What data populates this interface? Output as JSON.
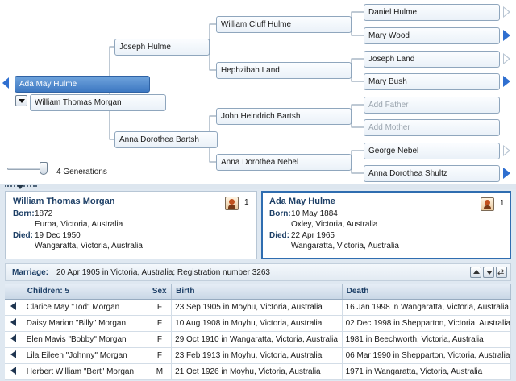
{
  "pedigree": {
    "root": "Ada May Hulme",
    "spouse": "William Thomas Morgan",
    "father": "Joseph Hulme",
    "mother": "Anna Dorothea Bartsh",
    "pat_grandfather": "William Cluff Hulme",
    "pat_grandmother": "Hephzibah Land",
    "mat_grandfather": "John Heindrich Bartsh",
    "mat_grandmother": "Anna Dorothea Nebel",
    "g1": "Daniel Hulme",
    "g2": "Mary Wood",
    "g3": "Joseph Land",
    "g4": "Mary Bush",
    "g5": "Add Father",
    "g6": "Add Mother",
    "g7": "George Nebel",
    "g8": "Anna Dorothea Shultz",
    "generations_label": "4 Generations",
    "generations": 4
  },
  "husband": {
    "name": "William Thomas Morgan",
    "born_label": "Born:",
    "born_date": "1872",
    "born_place": "Euroa, Victoria, Australia",
    "died_label": "Died:",
    "died_date": "19 Dec 1950",
    "died_place": "Wangaratta, Victoria, Australia",
    "count": "1",
    "icon": "male-person-icon"
  },
  "wife": {
    "name": "Ada May Hulme",
    "born_label": "Born:",
    "born_date": "10 May 1884",
    "born_place": "Oxley, Victoria, Australia",
    "died_label": "Died:",
    "died_date": "22 Apr 1965",
    "died_place": "Wangaratta, Victoria, Australia",
    "count": "1",
    "icon": "female-person-icon"
  },
  "marriage": {
    "label": "Marriage:",
    "value": "20 Apr 1905 in Victoria, Australia; Registration number 3263"
  },
  "children": {
    "headers": {
      "name": "Children: 5",
      "sex": "Sex",
      "birth": "Birth",
      "death": "Death"
    },
    "rows": [
      {
        "name": "Clarice May \"Tod\" Morgan",
        "sex": "F",
        "birth": "23 Sep 1905 in Moyhu, Victoria, Australia",
        "death": "16 Jan 1998 in Wangaratta, Victoria, Australia"
      },
      {
        "name": "Daisy Marion \"Billy\" Morgan",
        "sex": "F",
        "birth": "10 Aug 1908 in Moyhu, Victoria, Australia",
        "death": "02 Dec 1998 in Shepparton, Victoria, Australia"
      },
      {
        "name": "Elen Mavis \"Bobby\" Morgan",
        "sex": "F",
        "birth": "29 Oct 1910 in Wangaratta, Victoria, Australia",
        "death": "1981 in Beechworth, Victoria, Australia"
      },
      {
        "name": "Lila Eileen \"Johnny\" Morgan",
        "sex": "F",
        "birth": "23 Feb 1913 in Moyhu, Victoria, Australia",
        "death": "06 Mar 1990 in Shepparton, Victoria, Australia"
      },
      {
        "name": "Herbert William \"Bert\" Morgan",
        "sex": "M",
        "birth": "21 Oct 1926 in Moyhu, Victoria, Australia",
        "death": "1971 in Wangaratta, Victoria, Australia"
      }
    ]
  },
  "colors": {
    "accent": "#3d78c2",
    "expand_arrow": "#2f6fd0",
    "panel_bg": "#dfe8f1"
  }
}
